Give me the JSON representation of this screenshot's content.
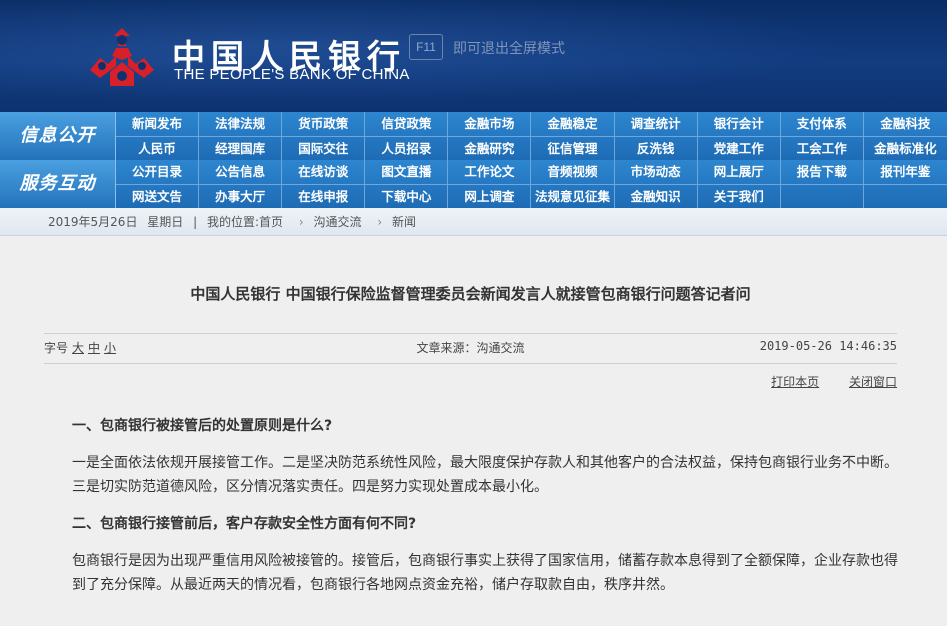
{
  "header": {
    "logo_cn": "中国人民银行",
    "logo_en": "THE PEOPLE'S BANK OF CHINA",
    "f11_key": "F11",
    "f11_hint": "即可退出全屏模式",
    "emblem_icon": "pboc-emblem-icon",
    "colors": {
      "banner": "#0e3270",
      "emblem": "#d8202a"
    }
  },
  "nav": {
    "section1": {
      "label": "信息公开",
      "row1": [
        "新闻发布",
        "法律法规",
        "货币政策",
        "信贷政策",
        "金融市场",
        "金融稳定",
        "调查统计",
        "银行会计",
        "支付体系",
        "金融科技"
      ],
      "row2": [
        "人民币",
        "经理国库",
        "国际交往",
        "人员招录",
        "金融研究",
        "征信管理",
        "反洗钱",
        "党建工作",
        "工会工作",
        "金融标准化"
      ]
    },
    "section2": {
      "label": "服务互动",
      "row1": [
        "公开目录",
        "公告信息",
        "在线访谈",
        "图文直播",
        "工作论文",
        "音频视频",
        "市场动态",
        "网上展厅",
        "报告下载",
        "报刊年鉴"
      ],
      "row2": [
        "网送文告",
        "办事大厅",
        "在线申报",
        "下载中心",
        "网上调查",
        "法规意见征集",
        "金融知识",
        "关于我们",
        "",
        ""
      ]
    }
  },
  "breadcrumb": {
    "date": "2019年5月26日",
    "weekday": "星期日",
    "sep": "|",
    "location_label": "我的位置:",
    "items": [
      "首页",
      "沟通交流",
      "新闻"
    ],
    "arrow": "›"
  },
  "article": {
    "title": "中国人民银行  中国银行保险监督管理委员会新闻发言人就接管包商银行问题答记者问",
    "font_label": "字号",
    "font_sizes": [
      "大",
      "中",
      "小"
    ],
    "source": "文章来源：沟通交流",
    "datetime": "2019-05-26 14:46:35",
    "print": "打印本页",
    "close": "关闭窗口",
    "q1": "一、包商银行被接管后的处置原则是什么?",
    "a1": "一是全面依法依规开展接管工作。二是坚决防范系统性风险，最大限度保护存款人和其他客户的合法权益，保持包商银行业务不中断。三是切实防范道德风险，区分情况落实责任。四是努力实现处置成本最小化。",
    "q2": "二、包商银行接管前后，客户存款安全性方面有何不同?",
    "a2": "包商银行是因为出现严重信用风险被接管的。接管后，包商银行事实上获得了国家信用，储蓄存款本息得到了全额保障，企业存款也得到了充分保障。从最近两天的情况看，包商银行各地网点资金充裕，储户存取款自由，秩序井然。"
  }
}
